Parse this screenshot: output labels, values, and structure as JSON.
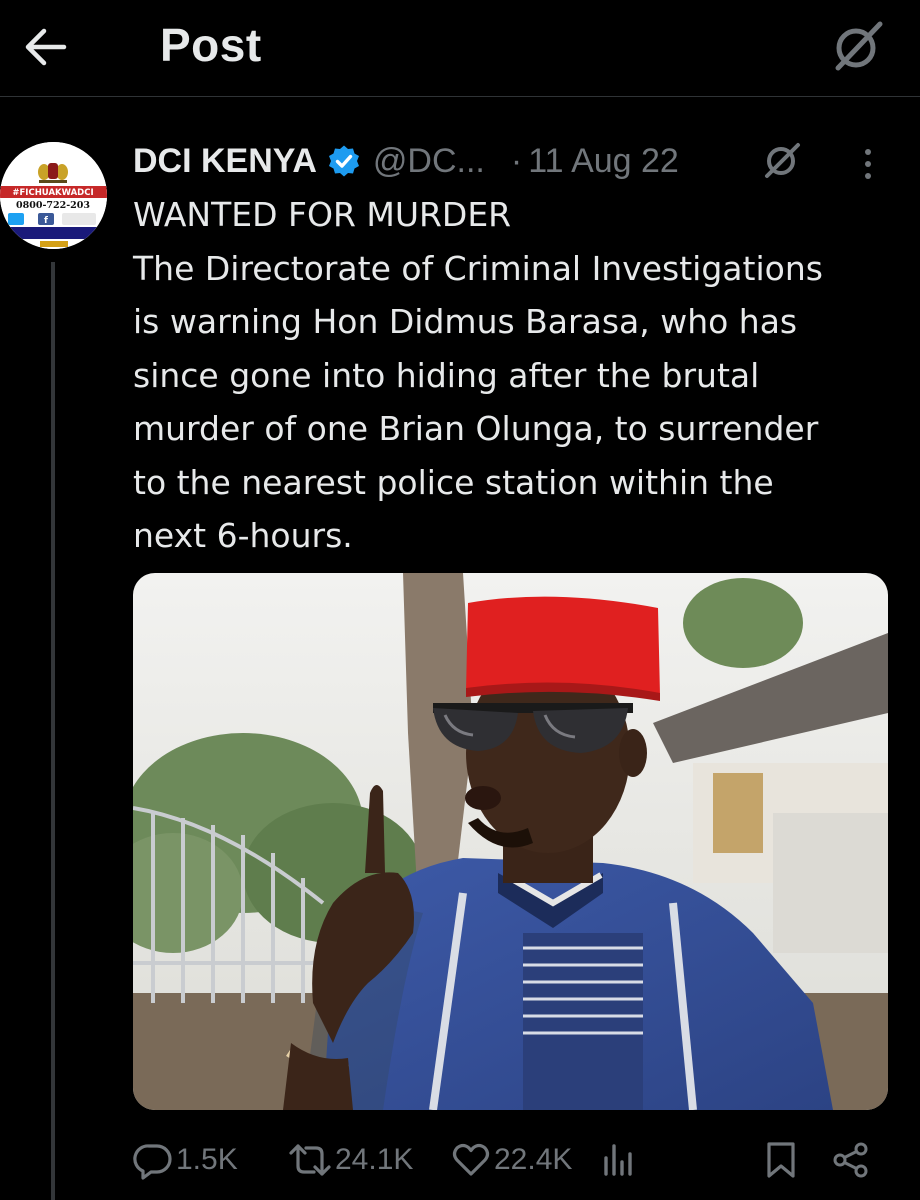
{
  "header": {
    "title": "Post"
  },
  "tweet": {
    "display_name": "DCI KENYA",
    "handle": "@DC...",
    "separator": "·",
    "date": "11 Aug 22",
    "avatar": {
      "banner_text": "#FICHUAKWADCI",
      "phone_text": "0800-722-203"
    },
    "text_lines": [
      "WANTED FOR MURDER",
      "The Directorate of Criminal Investigations",
      "is warning Hon Didmus Barasa, who has",
      "since gone into hiding after the brutal",
      "murder of one Brian Olunga, to surrender",
      "to the nearest police station within the",
      "next 6-hours."
    ]
  },
  "actions": {
    "replies": "1.5K",
    "reposts": "24.1K",
    "likes": "22.4K"
  },
  "colors": {
    "background": "#000000",
    "text": "#e7e9ea",
    "secondary": "#71767b",
    "verified": "#1d9bf0",
    "divider": "#2f3336"
  }
}
